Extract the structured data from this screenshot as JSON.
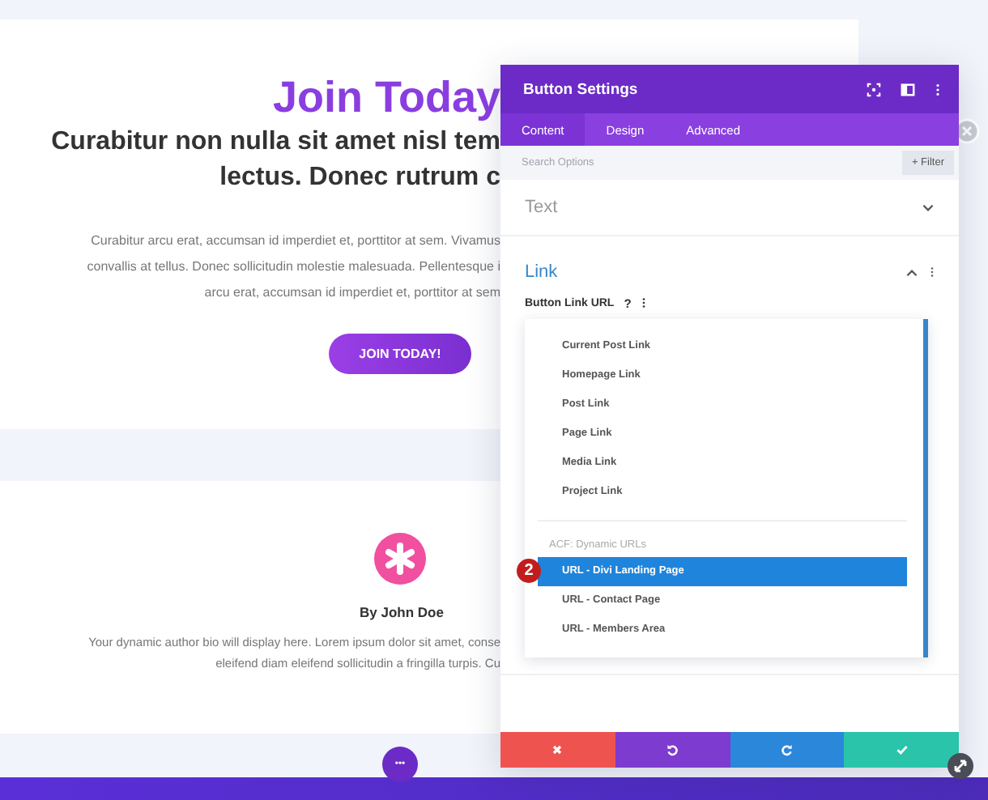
{
  "hero": {
    "title": "Join Today",
    "subtitle_lines": [
      "Curabitur non nulla sit amet nisl tem",
      "lectus. Donec rutrum c"
    ],
    "body_lines": [
      "Curabitur arcu erat, accumsan id imperdiet et, porttitor at sem. Vivamus",
      "convallis at tellus. Donec sollicitudin molestie malesuada. Pellentesque i",
      "arcu erat, accumsan id imperdiet et, porttitor at sem"
    ],
    "button": "JOIN TODAY!"
  },
  "author": {
    "name": "By John Doe",
    "bio_lines": [
      "Your dynamic author bio will display here. Lorem ipsum dolor sit amet, conse",
      "eleifend diam eleifend sollicitudin a fringilla turpis. Cu"
    ]
  },
  "dots_button": "•••",
  "panel": {
    "title": "Button Settings",
    "tabs": [
      {
        "label": "Content",
        "selected": true
      },
      {
        "label": "Design",
        "selected": false
      },
      {
        "label": "Advanced",
        "selected": false
      }
    ],
    "search": {
      "placeholder": "Search Options"
    },
    "filter_button": "+ Filter",
    "sections": [
      {
        "title": "Text",
        "expanded": false
      },
      {
        "title": "Link",
        "expanded": true
      }
    ],
    "field_label": "Button Link URL",
    "help": "?",
    "dropdown": [
      {
        "kind": "option",
        "label": "Current Post Link",
        "selected": false
      },
      {
        "kind": "option",
        "label": "Homepage Link",
        "selected": false
      },
      {
        "kind": "option",
        "label": "Post Link",
        "selected": false
      },
      {
        "kind": "option",
        "label": "Page Link",
        "selected": false
      },
      {
        "kind": "option",
        "label": "Media Link",
        "selected": false
      },
      {
        "kind": "option",
        "label": "Project Link",
        "selected": false
      },
      {
        "kind": "group",
        "label": "ACF: Dynamic URLs"
      },
      {
        "kind": "option",
        "label": "URL - Divi Landing Page",
        "selected": true
      },
      {
        "kind": "option",
        "label": "URL - Contact Page",
        "selected": false
      },
      {
        "kind": "option",
        "label": "URL - Members Area",
        "selected": false
      }
    ],
    "step_badge": "2",
    "footer_buttons": [
      {
        "kind": "cancel",
        "color": "#ef5350"
      },
      {
        "kind": "undo",
        "color": "#7e3bd0"
      },
      {
        "kind": "redo",
        "color": "#2b87da"
      },
      {
        "kind": "save",
        "color": "#29c4a9"
      }
    ]
  }
}
